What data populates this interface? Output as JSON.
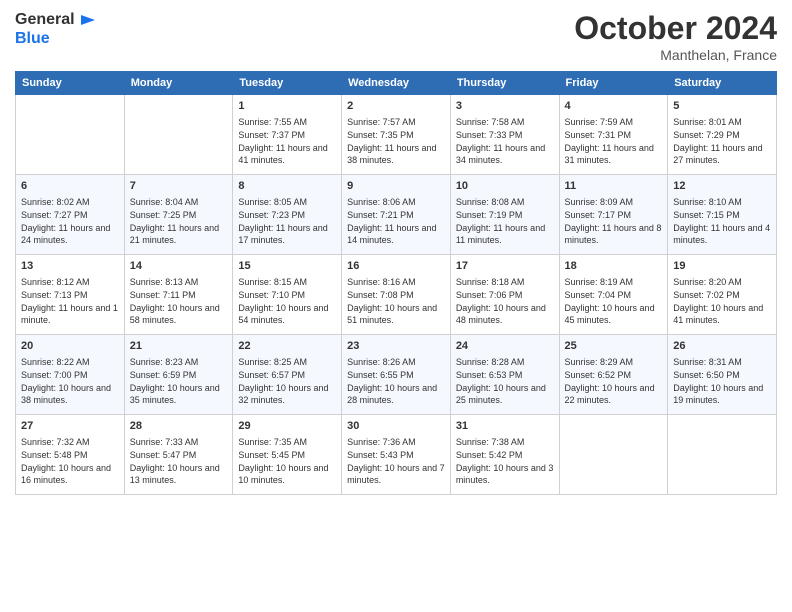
{
  "logo": {
    "line1": "General",
    "line2": "Blue"
  },
  "header": {
    "month": "October 2024",
    "location": "Manthelan, France"
  },
  "weekdays": [
    "Sunday",
    "Monday",
    "Tuesday",
    "Wednesday",
    "Thursday",
    "Friday",
    "Saturday"
  ],
  "weeks": [
    [
      null,
      null,
      {
        "day": "1",
        "sunrise": "Sunrise: 7:55 AM",
        "sunset": "Sunset: 7:37 PM",
        "daylight": "Daylight: 11 hours and 41 minutes."
      },
      {
        "day": "2",
        "sunrise": "Sunrise: 7:57 AM",
        "sunset": "Sunset: 7:35 PM",
        "daylight": "Daylight: 11 hours and 38 minutes."
      },
      {
        "day": "3",
        "sunrise": "Sunrise: 7:58 AM",
        "sunset": "Sunset: 7:33 PM",
        "daylight": "Daylight: 11 hours and 34 minutes."
      },
      {
        "day": "4",
        "sunrise": "Sunrise: 7:59 AM",
        "sunset": "Sunset: 7:31 PM",
        "daylight": "Daylight: 11 hours and 31 minutes."
      },
      {
        "day": "5",
        "sunrise": "Sunrise: 8:01 AM",
        "sunset": "Sunset: 7:29 PM",
        "daylight": "Daylight: 11 hours and 27 minutes."
      }
    ],
    [
      {
        "day": "6",
        "sunrise": "Sunrise: 8:02 AM",
        "sunset": "Sunset: 7:27 PM",
        "daylight": "Daylight: 11 hours and 24 minutes."
      },
      {
        "day": "7",
        "sunrise": "Sunrise: 8:04 AM",
        "sunset": "Sunset: 7:25 PM",
        "daylight": "Daylight: 11 hours and 21 minutes."
      },
      {
        "day": "8",
        "sunrise": "Sunrise: 8:05 AM",
        "sunset": "Sunset: 7:23 PM",
        "daylight": "Daylight: 11 hours and 17 minutes."
      },
      {
        "day": "9",
        "sunrise": "Sunrise: 8:06 AM",
        "sunset": "Sunset: 7:21 PM",
        "daylight": "Daylight: 11 hours and 14 minutes."
      },
      {
        "day": "10",
        "sunrise": "Sunrise: 8:08 AM",
        "sunset": "Sunset: 7:19 PM",
        "daylight": "Daylight: 11 hours and 11 minutes."
      },
      {
        "day": "11",
        "sunrise": "Sunrise: 8:09 AM",
        "sunset": "Sunset: 7:17 PM",
        "daylight": "Daylight: 11 hours and 8 minutes."
      },
      {
        "day": "12",
        "sunrise": "Sunrise: 8:10 AM",
        "sunset": "Sunset: 7:15 PM",
        "daylight": "Daylight: 11 hours and 4 minutes."
      }
    ],
    [
      {
        "day": "13",
        "sunrise": "Sunrise: 8:12 AM",
        "sunset": "Sunset: 7:13 PM",
        "daylight": "Daylight: 11 hours and 1 minute."
      },
      {
        "day": "14",
        "sunrise": "Sunrise: 8:13 AM",
        "sunset": "Sunset: 7:11 PM",
        "daylight": "Daylight: 10 hours and 58 minutes."
      },
      {
        "day": "15",
        "sunrise": "Sunrise: 8:15 AM",
        "sunset": "Sunset: 7:10 PM",
        "daylight": "Daylight: 10 hours and 54 minutes."
      },
      {
        "day": "16",
        "sunrise": "Sunrise: 8:16 AM",
        "sunset": "Sunset: 7:08 PM",
        "daylight": "Daylight: 10 hours and 51 minutes."
      },
      {
        "day": "17",
        "sunrise": "Sunrise: 8:18 AM",
        "sunset": "Sunset: 7:06 PM",
        "daylight": "Daylight: 10 hours and 48 minutes."
      },
      {
        "day": "18",
        "sunrise": "Sunrise: 8:19 AM",
        "sunset": "Sunset: 7:04 PM",
        "daylight": "Daylight: 10 hours and 45 minutes."
      },
      {
        "day": "19",
        "sunrise": "Sunrise: 8:20 AM",
        "sunset": "Sunset: 7:02 PM",
        "daylight": "Daylight: 10 hours and 41 minutes."
      }
    ],
    [
      {
        "day": "20",
        "sunrise": "Sunrise: 8:22 AM",
        "sunset": "Sunset: 7:00 PM",
        "daylight": "Daylight: 10 hours and 38 minutes."
      },
      {
        "day": "21",
        "sunrise": "Sunrise: 8:23 AM",
        "sunset": "Sunset: 6:59 PM",
        "daylight": "Daylight: 10 hours and 35 minutes."
      },
      {
        "day": "22",
        "sunrise": "Sunrise: 8:25 AM",
        "sunset": "Sunset: 6:57 PM",
        "daylight": "Daylight: 10 hours and 32 minutes."
      },
      {
        "day": "23",
        "sunrise": "Sunrise: 8:26 AM",
        "sunset": "Sunset: 6:55 PM",
        "daylight": "Daylight: 10 hours and 28 minutes."
      },
      {
        "day": "24",
        "sunrise": "Sunrise: 8:28 AM",
        "sunset": "Sunset: 6:53 PM",
        "daylight": "Daylight: 10 hours and 25 minutes."
      },
      {
        "day": "25",
        "sunrise": "Sunrise: 8:29 AM",
        "sunset": "Sunset: 6:52 PM",
        "daylight": "Daylight: 10 hours and 22 minutes."
      },
      {
        "day": "26",
        "sunrise": "Sunrise: 8:31 AM",
        "sunset": "Sunset: 6:50 PM",
        "daylight": "Daylight: 10 hours and 19 minutes."
      }
    ],
    [
      {
        "day": "27",
        "sunrise": "Sunrise: 7:32 AM",
        "sunset": "Sunset: 5:48 PM",
        "daylight": "Daylight: 10 hours and 16 minutes."
      },
      {
        "day": "28",
        "sunrise": "Sunrise: 7:33 AM",
        "sunset": "Sunset: 5:47 PM",
        "daylight": "Daylight: 10 hours and 13 minutes."
      },
      {
        "day": "29",
        "sunrise": "Sunrise: 7:35 AM",
        "sunset": "Sunset: 5:45 PM",
        "daylight": "Daylight: 10 hours and 10 minutes."
      },
      {
        "day": "30",
        "sunrise": "Sunrise: 7:36 AM",
        "sunset": "Sunset: 5:43 PM",
        "daylight": "Daylight: 10 hours and 7 minutes."
      },
      {
        "day": "31",
        "sunrise": "Sunrise: 7:38 AM",
        "sunset": "Sunset: 5:42 PM",
        "daylight": "Daylight: 10 hours and 3 minutes."
      },
      null,
      null
    ]
  ]
}
